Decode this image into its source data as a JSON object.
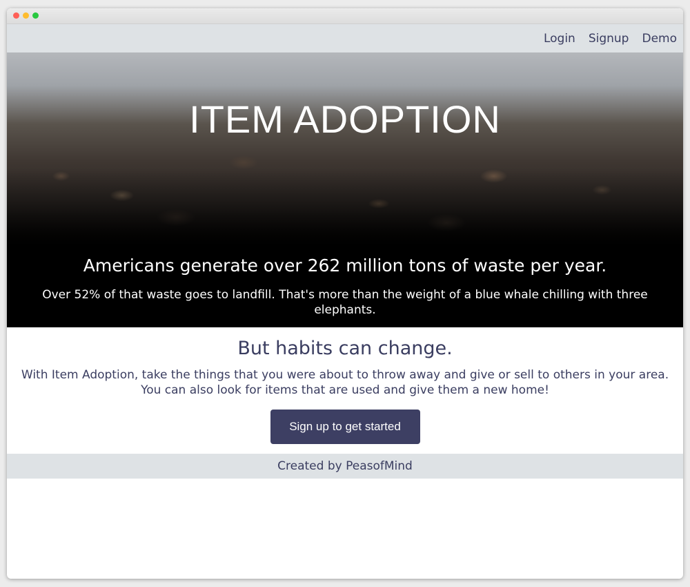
{
  "nav": {
    "links": [
      "Login",
      "Signup",
      "Demo"
    ]
  },
  "hero": {
    "title": "ITEM ADOPTION",
    "stat": "Americans generate over 262 million tons of waste per year.",
    "sub": "Over 52% of that waste goes to landfill. That's more than the weight of a blue whale chilling with three elephants."
  },
  "content": {
    "heading": "But habits can change.",
    "line1": "With Item Adoption, take the things that you were about to throw away and give or sell to others in your area.",
    "line2": "You can also look for items that are used and give them a new home!",
    "cta_label": "Sign up to get started"
  },
  "footer": {
    "text": "Created by PeasofMind"
  },
  "colors": {
    "accent": "#3d3f63",
    "text": "#3a3d60",
    "bar": "#dee2e5"
  },
  "hero_image": "landfill-waste-pile-photo"
}
